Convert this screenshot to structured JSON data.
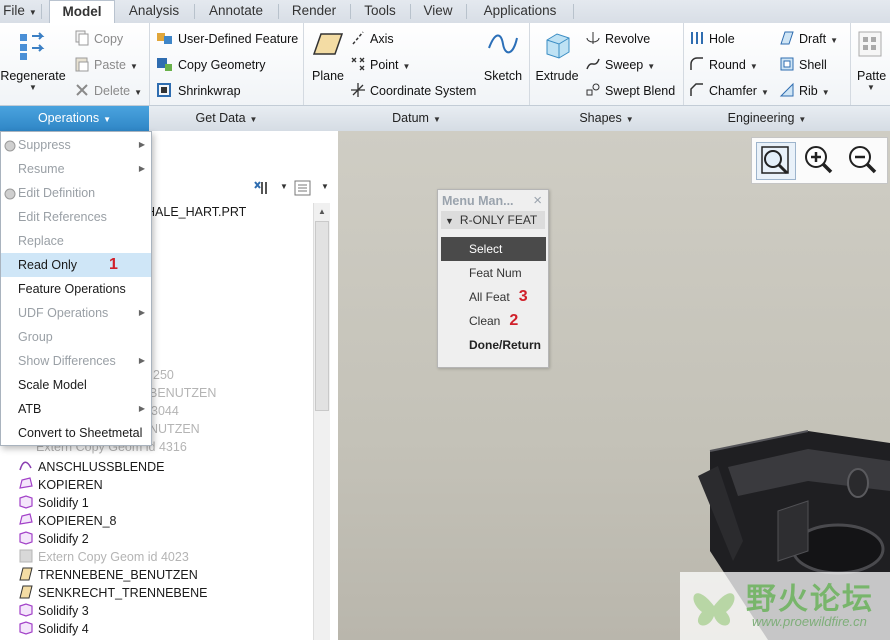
{
  "tabs": [
    {
      "label": "File",
      "active": false,
      "has_menu": true
    },
    {
      "label": "Model",
      "active": true
    },
    {
      "label": "Analysis",
      "active": false
    },
    {
      "label": "Annotate",
      "active": false
    },
    {
      "label": "Render",
      "active": false
    },
    {
      "label": "Tools",
      "active": false
    },
    {
      "label": "View",
      "active": false
    },
    {
      "label": "Applications",
      "active": false
    }
  ],
  "ribbon": {
    "operations": {
      "regenerate": "Regenerate",
      "copy": "Copy",
      "paste": "Paste",
      "delete": "Delete"
    },
    "get_data": {
      "user_defined_feature": "User-Defined Feature",
      "copy_geometry": "Copy Geometry",
      "shrinkwrap": "Shrinkwrap"
    },
    "datum": {
      "plane": "Plane",
      "axis": "Axis",
      "point": "Point",
      "coordinate_system": "Coordinate System",
      "sketch": "Sketch"
    },
    "shapes": {
      "extrude": "Extrude",
      "revolve": "Revolve",
      "sweep": "Sweep",
      "swept_blend": "Swept Blend"
    },
    "engineering": {
      "hole": "Hole",
      "round": "Round",
      "chamfer": "Chamfer",
      "draft": "Draft",
      "shell": "Shell",
      "rib": "Rib"
    },
    "editing": {
      "pattern": "Patte"
    }
  },
  "groups": {
    "operations": "Operations",
    "get_data": "Get Data",
    "datum": "Datum",
    "shapes": "Shapes",
    "engineering": "Engineering"
  },
  "operations_menu": [
    {
      "label": "Suppress",
      "enabled": false,
      "submenu": true
    },
    {
      "label": "Resume",
      "enabled": false,
      "submenu": true
    },
    {
      "label": "Edit Definition",
      "enabled": false
    },
    {
      "label": "Edit References",
      "enabled": false
    },
    {
      "label": "Replace",
      "enabled": false
    },
    {
      "label": "Read Only",
      "enabled": true,
      "highlighted": true,
      "step": "1"
    },
    {
      "label": "Feature Operations",
      "enabled": true
    },
    {
      "label": "UDF Operations",
      "enabled": false,
      "submenu": true
    },
    {
      "label": "Group",
      "enabled": false
    },
    {
      "label": "Show Differences",
      "enabled": false,
      "submenu": true
    },
    {
      "label": "Scale Model",
      "enabled": true
    },
    {
      "label": "ATB",
      "enabled": true,
      "submenu": true
    },
    {
      "label": "Convert to Sheetmetal",
      "enabled": true
    }
  ],
  "model_tree": {
    "root_fragment": "HALE_HART.PRT",
    "behind_menu": [
      {
        "text": "250",
        "dim": true
      },
      {
        "text": "BENUTZEN",
        "dim": true
      },
      {
        "text": "3044",
        "dim": true
      },
      {
        "text": "NUTZEN",
        "dim": true
      },
      {
        "text": "Extern Copy Geom id 4316",
        "dim": true
      }
    ],
    "items": [
      {
        "label": "ANSCHLUSSBLENDE",
        "icon": "sketch-icon",
        "dim": false
      },
      {
        "label": "KOPIEREN",
        "icon": "copy-surface-icon",
        "dim": false
      },
      {
        "label": "Solidify 1",
        "icon": "solidify-icon",
        "dim": false
      },
      {
        "label": "KOPIEREN_8",
        "icon": "copy-surface-icon",
        "dim": false
      },
      {
        "label": "Solidify 2",
        "icon": "solidify-icon",
        "dim": false
      },
      {
        "label": "Extern Copy Geom id 4023",
        "icon": "external-copy-icon",
        "dim": true
      },
      {
        "label": "TRENNEBENE_BENUTZEN",
        "icon": "datum-plane-icon",
        "dim": false
      },
      {
        "label": "SENKRECHT_TRENNEBENE",
        "icon": "datum-plane-icon",
        "dim": false
      },
      {
        "label": "Solidify 3",
        "icon": "solidify-icon",
        "dim": false
      },
      {
        "label": "Solidify 4",
        "icon": "solidify-icon",
        "dim": false
      }
    ]
  },
  "menu_manager": {
    "title": "Menu Man...",
    "close": "×",
    "section": "R-ONLY FEAT",
    "items": [
      {
        "label": "Select",
        "selected": true,
        "bold": false,
        "step": ""
      },
      {
        "label": "Feat Num",
        "selected": false,
        "bold": false,
        "step": ""
      },
      {
        "label": "All Feat",
        "selected": false,
        "bold": false,
        "step": "3"
      },
      {
        "label": "Clean",
        "selected": false,
        "bold": false,
        "step": "2"
      },
      {
        "label": "Done/Return",
        "selected": false,
        "bold": true,
        "step": ""
      }
    ]
  },
  "zoom_tools": [
    "zoom-window-icon",
    "zoom-in-icon",
    "zoom-out-icon"
  ],
  "watermark": {
    "cn": "野火论坛",
    "url": "www.proewildfire.cn"
  },
  "colors": {
    "accent": "#2f86c6",
    "step_marker": "#d0202a",
    "highlight": "#cfe6f7"
  }
}
